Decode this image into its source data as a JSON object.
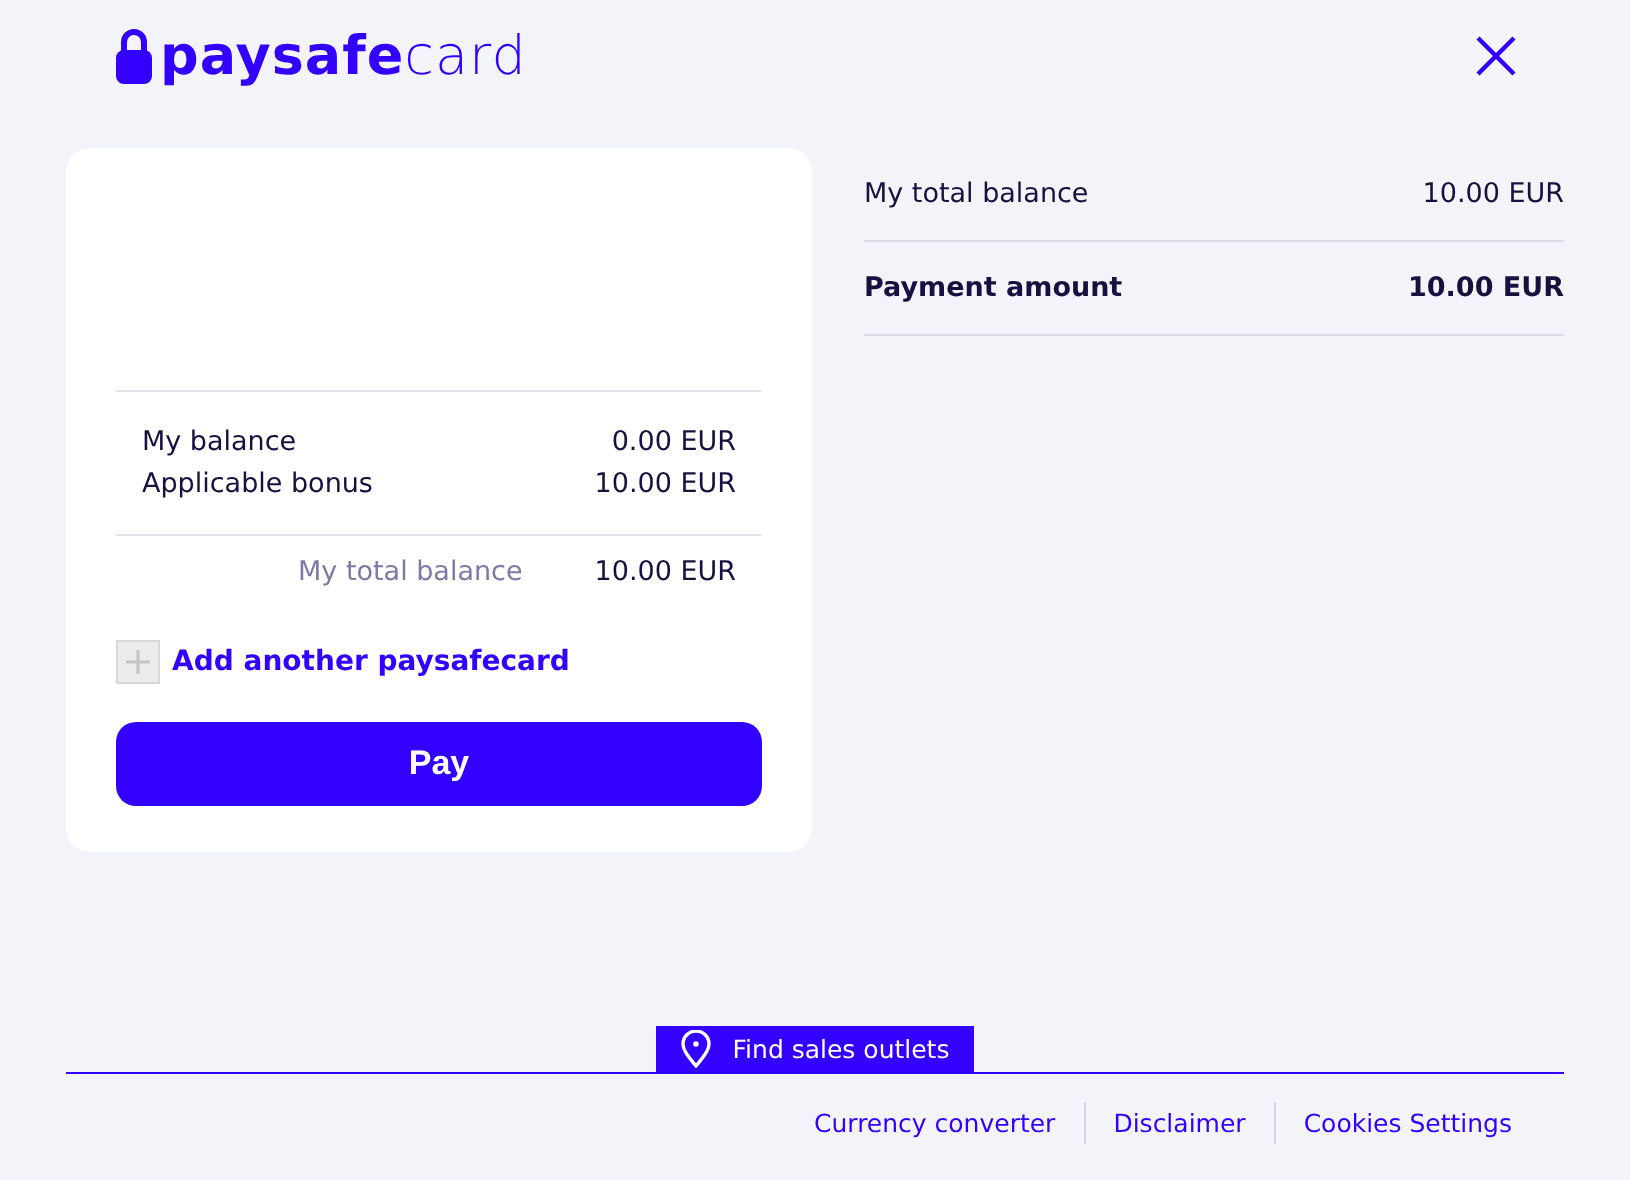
{
  "header": {
    "logo": "**paysafe**card"
  },
  "card": {
    "rows": [
      {
        "label": "My balance",
        "value": "0.00 EUR"
      },
      {
        "label": "Applicable bonus",
        "value": "10.00 EUR"
      }
    ],
    "total": {
      "label": "My total balance",
      "value": "10.00 EUR"
    },
    "add_link": "Add another paysafecard",
    "pay_button": "Pay"
  },
  "summary": [
    {
      "label": "My total balance",
      "value": "10.00 EUR",
      "bold": false
    },
    {
      "label": "Payment amount",
      "value": "10.00 EUR",
      "bold": true
    }
  ],
  "footer": {
    "find_button": "Find sales outlets",
    "links": [
      "Currency converter",
      "Disclaimer",
      "Cookies Settings"
    ]
  }
}
